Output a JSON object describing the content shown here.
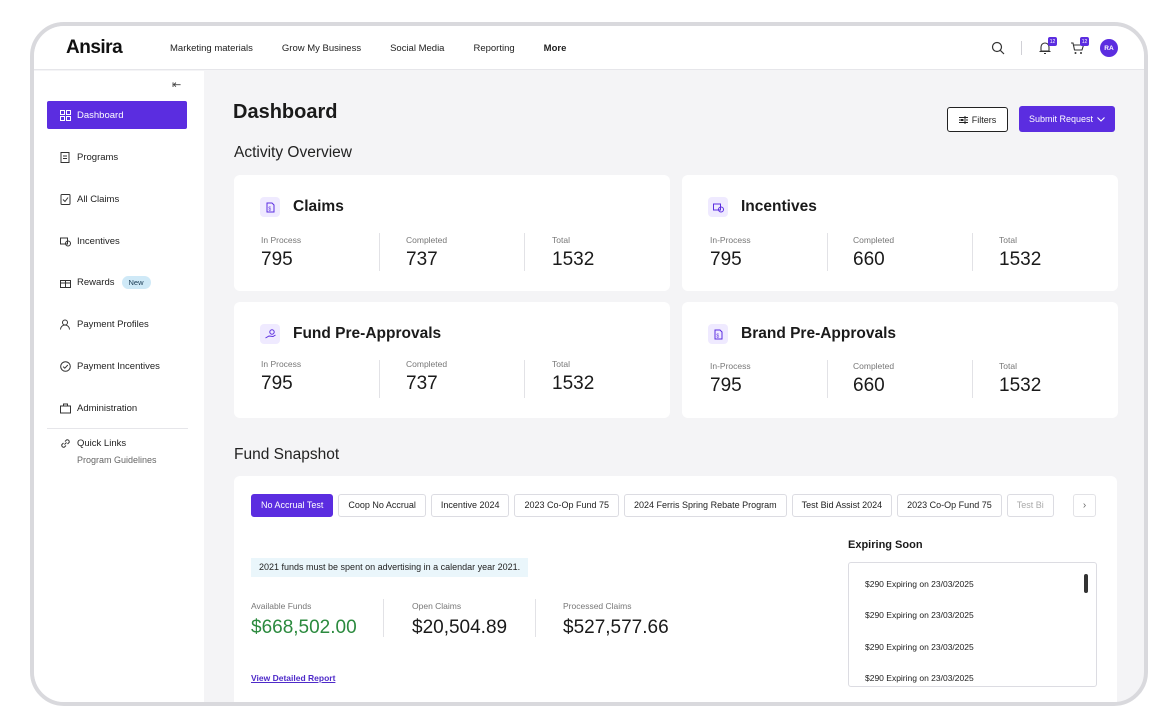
{
  "app": {
    "brand": "Ansira"
  },
  "nav": {
    "items": [
      "Marketing materials",
      "Grow My Business",
      "Social Media",
      "Reporting",
      "More"
    ]
  },
  "header_icons": {
    "notifications_badge": "12",
    "cart_badge": "12",
    "avatar_initials": "RA",
    "accent_color": "#5b2de0"
  },
  "sidebar": {
    "collapse_icon": "collapse-left-icon",
    "items": [
      {
        "label": "Dashboard",
        "icon": "dashboard-icon",
        "active": true
      },
      {
        "label": "Programs",
        "icon": "programs-icon"
      },
      {
        "label": "All Claims",
        "icon": "claims-check-icon"
      },
      {
        "label": "Incentives",
        "icon": "incentives-icon"
      },
      {
        "label": "Rewards",
        "icon": "gift-icon",
        "badge": "New"
      },
      {
        "label": "Payment Profiles",
        "icon": "user-profile-icon"
      },
      {
        "label": "Payment Incentives",
        "icon": "badge-check-icon"
      },
      {
        "label": "Administration",
        "icon": "briefcase-icon"
      }
    ],
    "quick_links": {
      "title": "Quick Links",
      "sub": "Program Guidelines"
    }
  },
  "page": {
    "title": "Dashboard",
    "filters_label": "Filters",
    "submit_label": "Submit Request",
    "activity_title": "Activity Overview",
    "fund_title": "Fund Snapshot"
  },
  "cards": [
    {
      "title": "Claims",
      "stats": [
        {
          "label": "In Process",
          "value": "795"
        },
        {
          "label": "Completed",
          "value": "737"
        },
        {
          "label": "Total",
          "value": "1532"
        }
      ]
    },
    {
      "title": "Incentives",
      "stats": [
        {
          "label": "In-Process",
          "value": "795"
        },
        {
          "label": "Completed",
          "value": "660"
        },
        {
          "label": "Total",
          "value": "1532"
        }
      ]
    },
    {
      "title": "Fund Pre-Approvals",
      "stats": [
        {
          "label": "In Process",
          "value": "795"
        },
        {
          "label": "Completed",
          "value": "737"
        },
        {
          "label": "Total",
          "value": "1532"
        }
      ]
    },
    {
      "title": "Brand Pre-Approvals",
      "stats": [
        {
          "label": "In-Process",
          "value": "795"
        },
        {
          "label": "Completed",
          "value": "660"
        },
        {
          "label": "Total",
          "value": "1532"
        }
      ]
    }
  ],
  "fund": {
    "chips": [
      "No Accrual Test",
      "Coop No Accrual",
      "Incentive 2024",
      "2023 Co-Op Fund 75",
      "2024 Ferris Spring Rebate Program",
      "Test Bid Assist 2024",
      "2023 Co-Op Fund 75",
      "Test Bi"
    ],
    "note": "2021 funds must be spent on advertising in a calendar year 2021.",
    "stats": [
      {
        "label": "Available Funds",
        "value": "$668,502.00"
      },
      {
        "label": "Open Claims",
        "value": "$20,504.89"
      },
      {
        "label": "Processed Claims",
        "value": "$527,577.66"
      }
    ],
    "report_link": "View Detailed Report",
    "expiring_title": "Expiring Soon",
    "expiring": [
      "$290 Expiring on 23/03/2025",
      "$290 Expiring on 23/03/2025",
      "$290 Expiring on 23/03/2025",
      "$290 Expiring on 23/03/2025"
    ],
    "available_color": "#2b8a3e"
  }
}
